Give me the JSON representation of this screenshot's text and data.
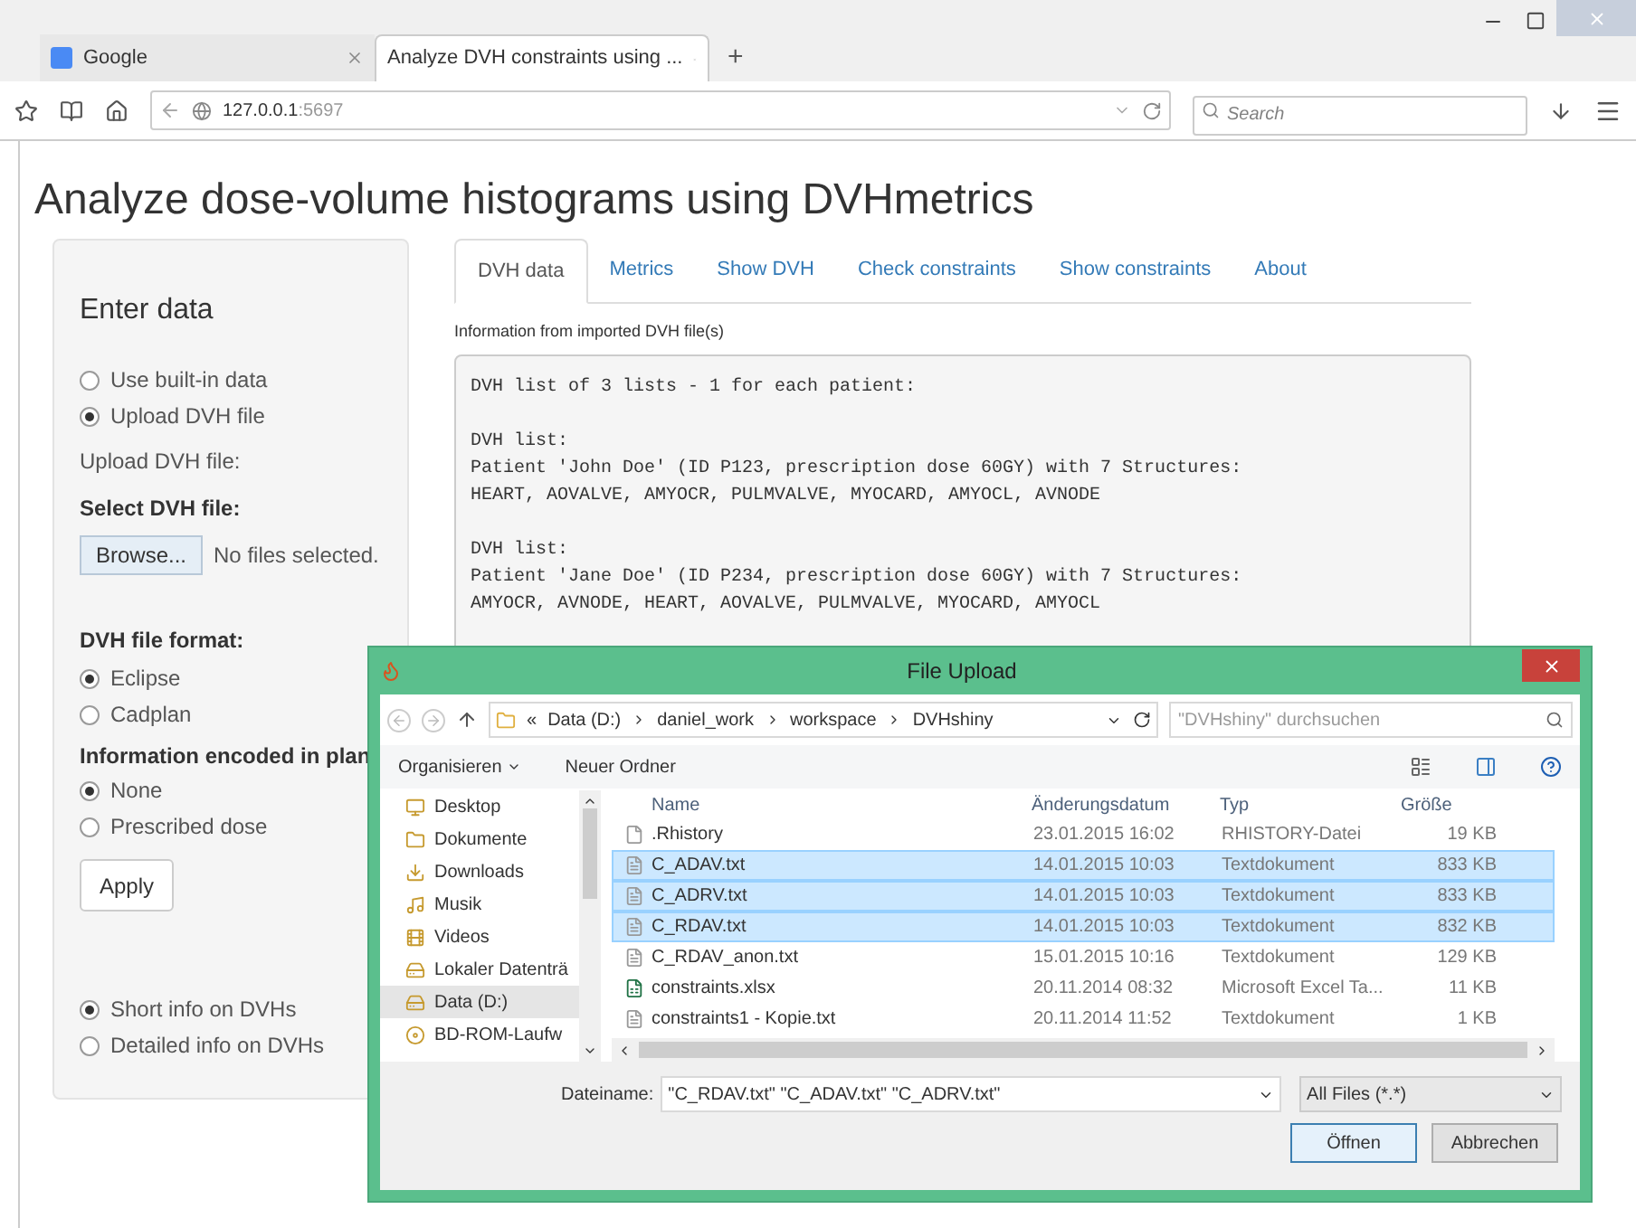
{
  "browser": {
    "tabs": [
      {
        "title": "Google",
        "selected": false
      },
      {
        "title": "Analyze DVH constraints using ...",
        "selected": true
      }
    ],
    "new_tab": "+",
    "address": {
      "host": "127.0.0.1",
      "port": ":5697"
    },
    "search": {
      "placeholder": "Search"
    }
  },
  "page": {
    "title": "Analyze dose-volume histograms using DVHmetrics",
    "sidebar": {
      "heading": "Enter data",
      "source_options": [
        {
          "label": "Use built-in data",
          "selected": false
        },
        {
          "label": "Upload DVH file",
          "selected": true
        }
      ],
      "upload_label": "Upload DVH file:",
      "select_label": "Select DVH file:",
      "browse_button": "Browse...",
      "file_status": "No files selected.",
      "format_label": "DVH file format:",
      "format_options": [
        {
          "label": "Eclipse",
          "selected": true
        },
        {
          "label": "Cadplan",
          "selected": false
        }
      ],
      "plan_label": "Information encoded in plan",
      "plan_options": [
        {
          "label": "None",
          "selected": true
        },
        {
          "label": "Prescribed dose",
          "selected": false
        }
      ],
      "apply_button": "Apply",
      "info_options": [
        {
          "label": "Short info on DVHs",
          "selected": true
        },
        {
          "label": "Detailed info on DVHs",
          "selected": false
        }
      ]
    },
    "tabs": [
      {
        "label": "DVH data",
        "selected": true
      },
      {
        "label": "Metrics",
        "selected": false
      },
      {
        "label": "Show DVH",
        "selected": false
      },
      {
        "label": "Check constraints",
        "selected": false
      },
      {
        "label": "Show constraints",
        "selected": false
      },
      {
        "label": "About",
        "selected": false
      }
    ],
    "output_label": "Information from imported DVH file(s)",
    "output_blocks": [
      [
        "DVH list of 3 lists - 1 for each patient:"
      ],
      [
        "DVH list:",
        "Patient 'John Doe' (ID P123, prescription dose 60GY) with 7 Structures:",
        "HEART, AOVALVE, AMYOCR, PULMVALVE, MYOCARD, AMYOCL, AVNODE"
      ],
      [
        "DVH list:",
        "Patient 'Jane Doe' (ID P234, prescription dose 60GY) with 7 Structures:",
        "AMYOCR, AVNODE, HEART, AOVALVE, PULMVALVE, MYOCARD, AMYOCL"
      ]
    ]
  },
  "dialog": {
    "title": "File Upload",
    "path_prefix": "«",
    "path": [
      "Data (D:)",
      "daniel_work",
      "workspace",
      "DVHshiny"
    ],
    "search": {
      "placeholder": "\"DVHshiny\" durchsuchen"
    },
    "commands": [
      "Organisieren",
      "Neuer Ordner"
    ],
    "nav": [
      {
        "label": "Desktop",
        "kind": "desktop",
        "selected": false
      },
      {
        "label": "Dokumente",
        "kind": "folder",
        "selected": false
      },
      {
        "label": "Downloads",
        "kind": "download",
        "selected": false
      },
      {
        "label": "Musik",
        "kind": "music",
        "selected": false
      },
      {
        "label": "Videos",
        "kind": "video",
        "selected": false
      },
      {
        "label": "Lokaler Datenträ",
        "kind": "drive",
        "selected": false
      },
      {
        "label": "Data (D:)",
        "kind": "drive",
        "selected": true
      },
      {
        "label": "BD-ROM-Laufw",
        "kind": "disc",
        "selected": false
      }
    ],
    "columns": [
      "Name",
      "Änderungsdatum",
      "Typ",
      "Größe"
    ],
    "files": [
      {
        "name": ".Rhistory",
        "date": "23.01.2015 16:02",
        "type": "RHISTORY-Datei",
        "size": "19 KB",
        "kind": "file",
        "selected": false
      },
      {
        "name": "C_ADAV.txt",
        "date": "14.01.2015 10:03",
        "type": "Textdokument",
        "size": "833 KB",
        "kind": "text",
        "selected": true
      },
      {
        "name": "C_ADRV.txt",
        "date": "14.01.2015 10:03",
        "type": "Textdokument",
        "size": "833 KB",
        "kind": "text",
        "selected": true
      },
      {
        "name": "C_RDAV.txt",
        "date": "14.01.2015 10:03",
        "type": "Textdokument",
        "size": "832 KB",
        "kind": "text",
        "selected": true
      },
      {
        "name": "C_RDAV_anon.txt",
        "date": "15.01.2015 10:16",
        "type": "Textdokument",
        "size": "129 KB",
        "kind": "text",
        "selected": false
      },
      {
        "name": "constraints.xlsx",
        "date": "20.11.2014 08:32",
        "type": "Microsoft Excel Ta...",
        "size": "11 KB",
        "kind": "sheet",
        "selected": false
      },
      {
        "name": "constraints1 - Kopie.txt",
        "date": "20.11.2014 11:52",
        "type": "Textdokument",
        "size": "1 KB",
        "kind": "text",
        "selected": false
      }
    ],
    "filename_label": "Dateiname:",
    "filename": "\"C_RDAV.txt\" \"C_ADAV.txt\" \"C_ADRV.txt\"",
    "filter": "All Files (*.*)",
    "open_button": "Öffnen",
    "cancel_button": "Abbrechen"
  }
}
